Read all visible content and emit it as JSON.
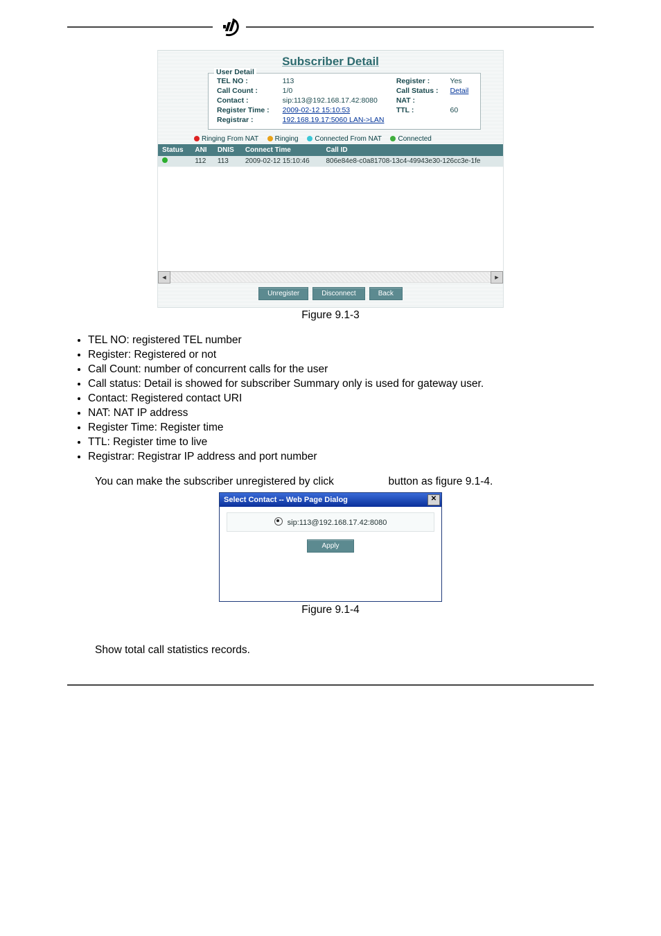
{
  "scr1": {
    "heading": "Subscriber Detail",
    "user_detail": {
      "legend": "User Detail",
      "rows": [
        {
          "k": "TEL NO :",
          "v": "113",
          "k2": "Register :",
          "v2": "Yes"
        },
        {
          "k": "Call Count :",
          "v": "1/0",
          "k2": "Call Status :",
          "v2": "Detail",
          "v2_link": true
        },
        {
          "k": "Contact :",
          "v": "sip:113@192.168.17.42:8080",
          "k2": "NAT :",
          "v2": ""
        },
        {
          "k": "Register Time :",
          "v": "2009-02-12 15:10:53",
          "k2": "TTL :",
          "v2": "60",
          "v_link": true
        },
        {
          "k": "Registrar :",
          "v": "192.168.19.17:5060 LAN->LAN",
          "k2": "",
          "v2": "",
          "v_link": true
        }
      ]
    },
    "legend_items": [
      {
        "color": "d-red",
        "label": "Ringing From NAT"
      },
      {
        "color": "d-orange",
        "label": "Ringing"
      },
      {
        "color": "d-cyan",
        "label": "Connected From NAT"
      },
      {
        "color": "d-green",
        "label": "Connected"
      }
    ],
    "grid": {
      "cols": [
        "Status",
        "ANI",
        "DNIS",
        "Connect Time",
        "Call ID"
      ],
      "row": {
        "ani": "112",
        "dnis": "113",
        "time": "2009-02-12 15:10:46",
        "callid": "806e84e8-c0a81708-13c4-49943e30-126cc3e-1fe"
      }
    },
    "buttons": [
      "Unregister",
      "Disconnect",
      "Back"
    ],
    "figure": "Figure 9.1-3"
  },
  "bullets": [
    "TEL NO: registered TEL number",
    "Register: Registered or not",
    "Call Count: number of concurrent calls for the user",
    "Call status: Detail is showed for subscriber Summary only is used for gateway user.",
    "Contact: Registered contact URI",
    "NAT: NAT IP address",
    "Register Time: Register time",
    "TTL: Register time to live",
    "Registrar: Registrar IP address and port number"
  ],
  "para1_a": "You can make the subscriber unregistered by click",
  "para1_b": "button as figure 9.1-4.",
  "scr2": {
    "title": "Select Contact -- Web Page Dialog",
    "option": "sip:113@192.168.17.42:8080",
    "apply": "Apply",
    "figure": "Figure 9.1-4"
  },
  "para2": "Show total call statistics records."
}
